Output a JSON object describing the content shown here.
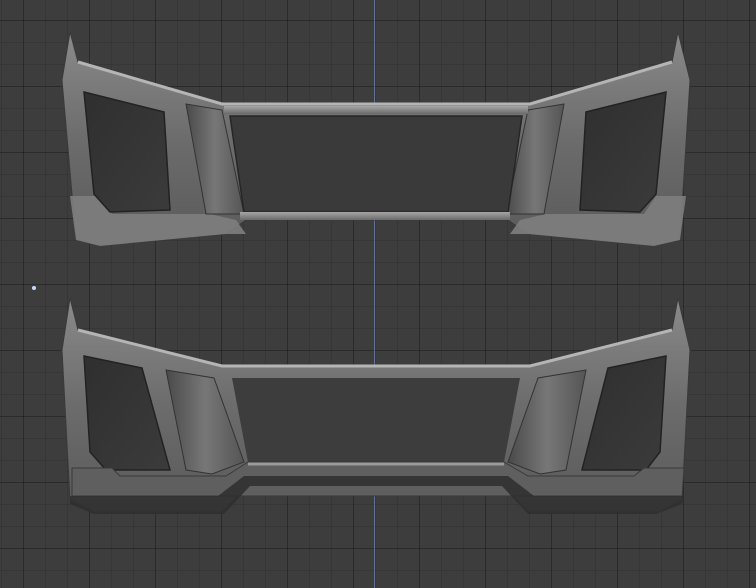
{
  "viewport": {
    "background": "#3d3d3d",
    "axis_color": "#5577c8",
    "models": [
      {
        "name": "bumper-top",
        "shade": "#6e6e6e"
      },
      {
        "name": "bumper-bottom",
        "shade": "#6a6a6a"
      }
    ]
  }
}
